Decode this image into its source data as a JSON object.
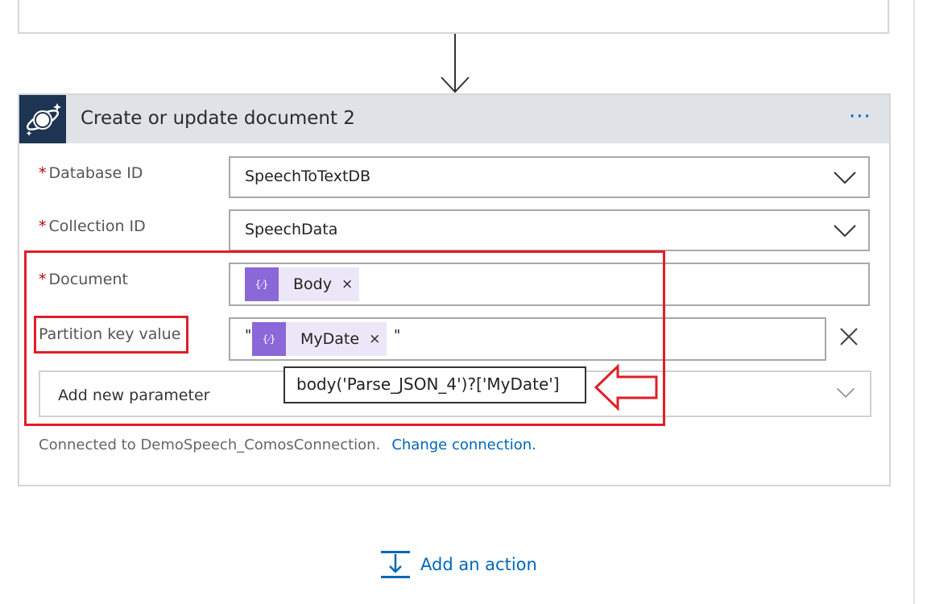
{
  "card": {
    "title": "Create or update document 2",
    "more_label": "···",
    "required_mark": "*"
  },
  "fields": {
    "database_id": {
      "label": "Database ID",
      "value": "SpeechToTextDB"
    },
    "collection_id": {
      "label": "Collection ID",
      "value": "SpeechData"
    },
    "document": {
      "label": "Document",
      "token_label": "Body",
      "token_remove": "×"
    },
    "partition_key": {
      "label": "Partition key value",
      "quote_open": "\"",
      "quote_close": "\"",
      "token_label": "MyDate",
      "token_remove": "×",
      "clear": "×"
    }
  },
  "token_icon_glyph": "{⁄}",
  "add_parameter": {
    "label": "Add new parameter"
  },
  "connection": {
    "text": "Connected to DemoSpeech_ComosConnection.",
    "change_label": "Change connection."
  },
  "tooltip": {
    "text": "body('Parse_JSON_4')?['MyDate']"
  },
  "add_action": {
    "label": "Add an action"
  },
  "colors": {
    "accent": "#0067b8",
    "highlight": "#e01e26",
    "token": "#8b68d8",
    "header_bg": "#dfe3e8",
    "icon_bg": "#1d3452"
  },
  "icons": {
    "card_icon": "cosmos-db-planet-icon",
    "menu": "more-options-icon",
    "dropdown": "chevron-down-icon",
    "token": "expression-icon",
    "flow": "arrow-down-icon",
    "add": "add-action-icon",
    "annotation": "red-arrow-left-icon"
  }
}
